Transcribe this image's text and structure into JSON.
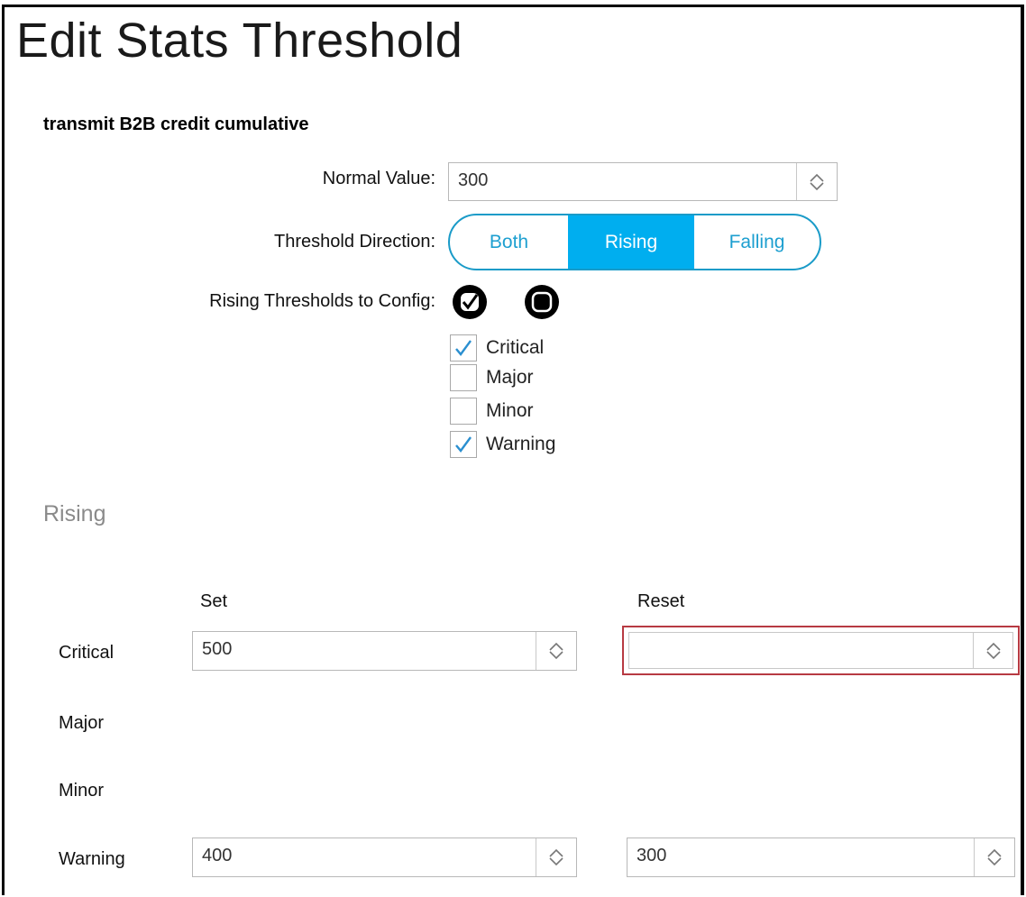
{
  "title": "Edit Stats Threshold",
  "stat_name": "transmit B2B credit cumulative",
  "normal_value": {
    "label": "Normal Value:",
    "value": "300"
  },
  "threshold_direction": {
    "label": "Threshold Direction:",
    "options": [
      "Both",
      "Rising",
      "Falling"
    ],
    "selected": "Rising"
  },
  "rising_config": {
    "label": "Rising Thresholds to Config:",
    "select_all_icon": "check-circle-icon",
    "clear_all_icon": "stop-circle-icon",
    "items": [
      {
        "label": "Critical",
        "checked": true
      },
      {
        "label": "Major",
        "checked": false
      },
      {
        "label": "Minor",
        "checked": false
      },
      {
        "label": "Warning",
        "checked": true
      }
    ]
  },
  "rising_section": {
    "heading": "Rising",
    "col_set": "Set",
    "col_reset": "Reset",
    "rows": [
      {
        "label": "Critical",
        "set": "500",
        "reset": "",
        "reset_error": true
      },
      {
        "label": "Major"
      },
      {
        "label": "Minor"
      },
      {
        "label": "Warning",
        "set": "400",
        "reset": "300"
      }
    ]
  },
  "colors": {
    "accent": "#00aeef",
    "accent_border": "#1a9bc8",
    "error": "#b73a42",
    "check": "#2a8fd0"
  }
}
